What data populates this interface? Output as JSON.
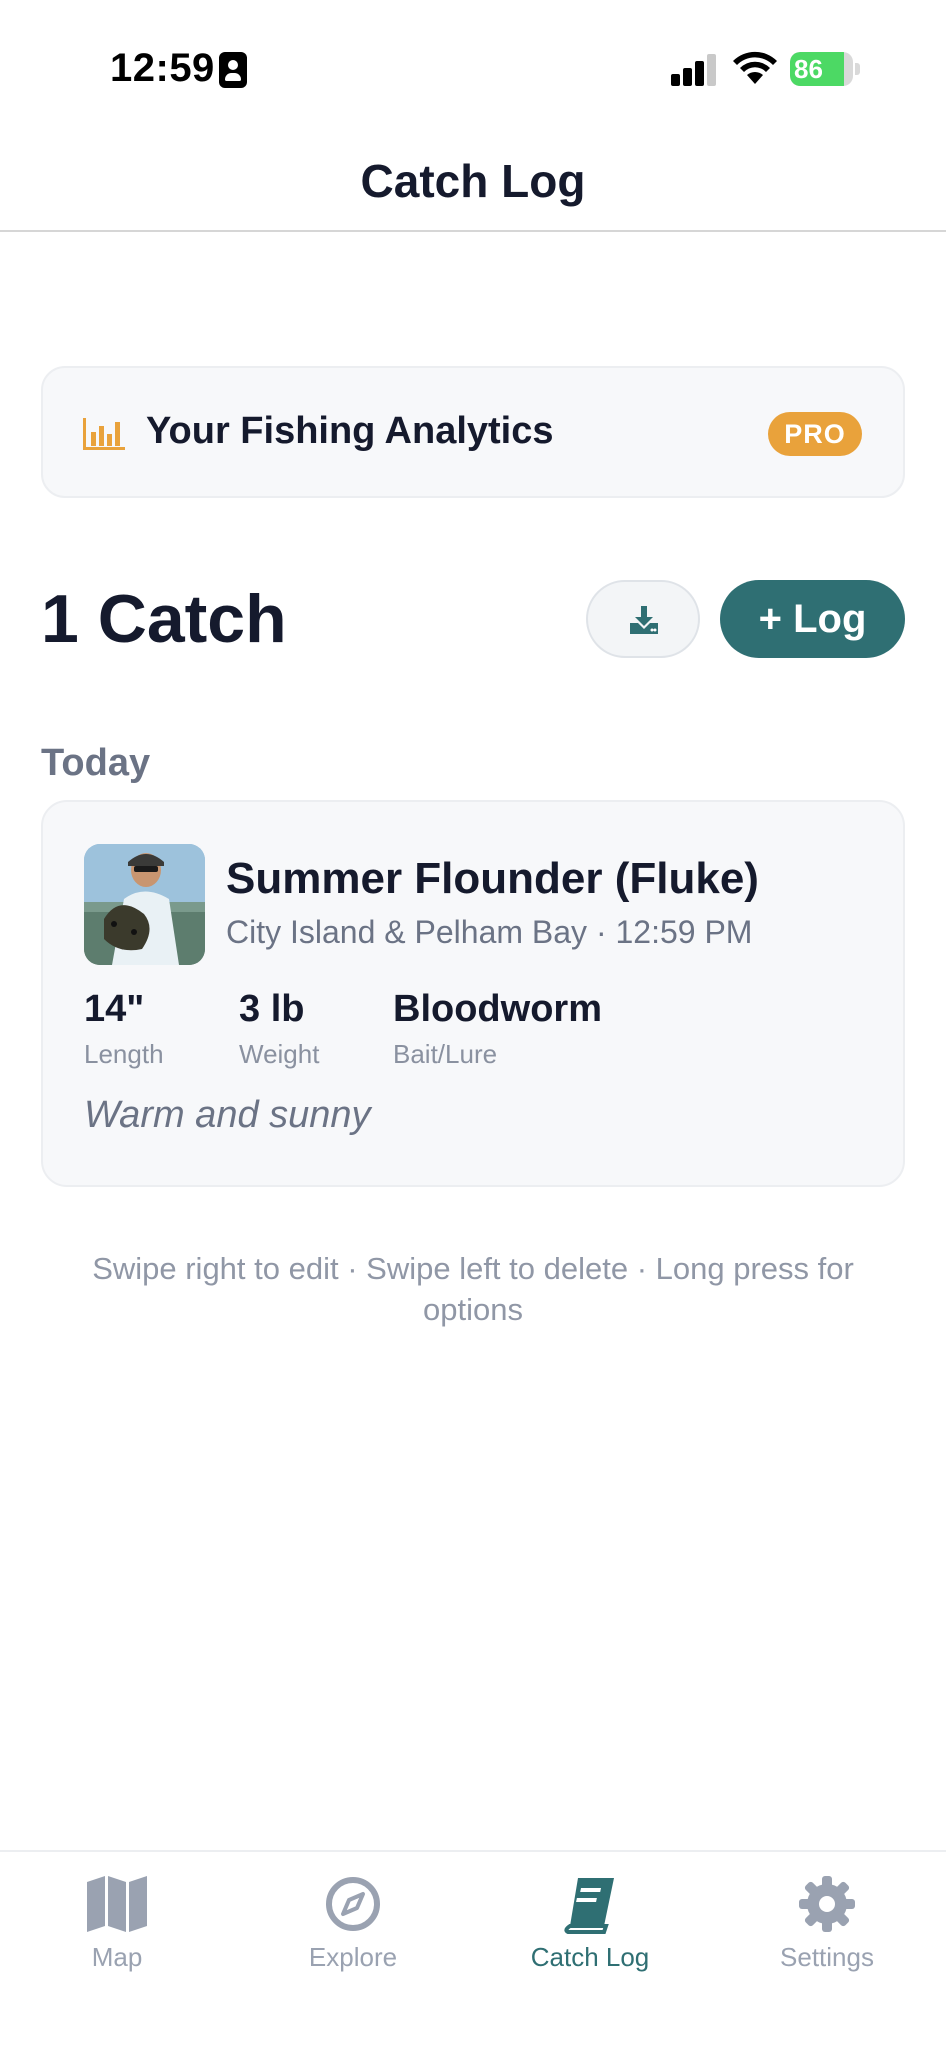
{
  "status_bar": {
    "time": "12:59",
    "battery_level": "86",
    "battery_fraction": 0.86,
    "battery_color": "#4cd964"
  },
  "header": {
    "title": "Catch Log"
  },
  "analytics": {
    "icon": "bar-chart-icon",
    "title": "Your Fishing Analytics",
    "badge": "PRO",
    "badge_color": "#e9a23b"
  },
  "catch_summary": {
    "count_label": "1 Catch",
    "export_icon": "download-icon",
    "log_button_label": "+ Log",
    "accent_color": "#2f6f73"
  },
  "sections": [
    {
      "label": "Today",
      "catches": [
        {
          "species": "Summer Flounder (Fluke)",
          "location_time": "City Island & Pelham Bay · 12:59 PM",
          "stats": [
            {
              "value": "14\"",
              "label": "Length"
            },
            {
              "value": "3 lb",
              "label": "Weight"
            },
            {
              "value": "Bloodworm",
              "label": "Bait/Lure"
            }
          ],
          "note": "Warm and sunny"
        }
      ]
    }
  ],
  "hint": "Swipe right to edit · Swipe left to delete · Long press for options",
  "tab_bar": {
    "tabs": [
      {
        "label": "Map",
        "icon": "map-icon",
        "active": false
      },
      {
        "label": "Explore",
        "icon": "compass-icon",
        "active": false
      },
      {
        "label": "Catch Log",
        "icon": "book-icon",
        "active": true
      },
      {
        "label": "Settings",
        "icon": "gear-icon",
        "active": false
      }
    ]
  }
}
